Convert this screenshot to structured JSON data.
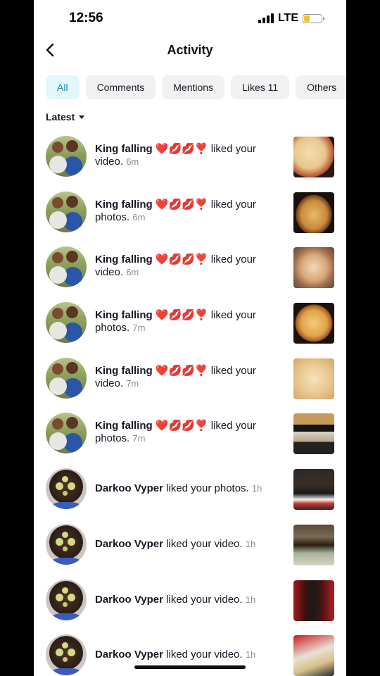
{
  "status_bar": {
    "time": "12:56",
    "network": "LTE",
    "battery_color": "#f5c518"
  },
  "header": {
    "title": "Activity",
    "back_icon": "chevron-left-icon"
  },
  "tabs": [
    {
      "label": "All",
      "active": true
    },
    {
      "label": "Comments",
      "active": false
    },
    {
      "label": "Mentions",
      "active": false
    },
    {
      "label": "Likes 11",
      "active": false
    },
    {
      "label": "Others",
      "active": false
    }
  ],
  "filter": {
    "label": "Latest"
  },
  "notifications": [
    {
      "name": "King falling",
      "emojis": "❤️💋💋❣️",
      "action": " liked your video.",
      "time": "6m"
    },
    {
      "name": "King falling",
      "emojis": "❤️💋💋❣️",
      "action": " liked your photos.",
      "time": "6m"
    },
    {
      "name": "King falling",
      "emojis": "❤️💋💋❣️",
      "action": " liked your video.",
      "time": "6m"
    },
    {
      "name": "King falling",
      "emojis": "❤️💋💋❣️",
      "action": " liked your photos.",
      "time": "7m"
    },
    {
      "name": "King falling",
      "emojis": "❤️💋💋❣️",
      "action": " liked your video.",
      "time": "7m"
    },
    {
      "name": "King falling",
      "emojis": "❤️💋💋❣️",
      "action": " liked your photos.",
      "time": "7m"
    },
    {
      "name": "Darkoo Vyper",
      "emojis": "",
      "action": " liked your photos.",
      "time": "1h"
    },
    {
      "name": "Darkoo Vyper",
      "emojis": "",
      "action": " liked your video.",
      "time": "1h"
    },
    {
      "name": "Darkoo Vyper",
      "emojis": "",
      "action": " liked your video.",
      "time": "1h"
    },
    {
      "name": "Darkoo Vyper",
      "emojis": "",
      "action": " liked your video.",
      "time": "1h"
    }
  ],
  "colors": {
    "active_tab_bg": "#e2f6fb",
    "active_tab_text": "#1b8aa3",
    "tab_bg": "#f1f1f2",
    "time_gray": "#8a8b91"
  }
}
